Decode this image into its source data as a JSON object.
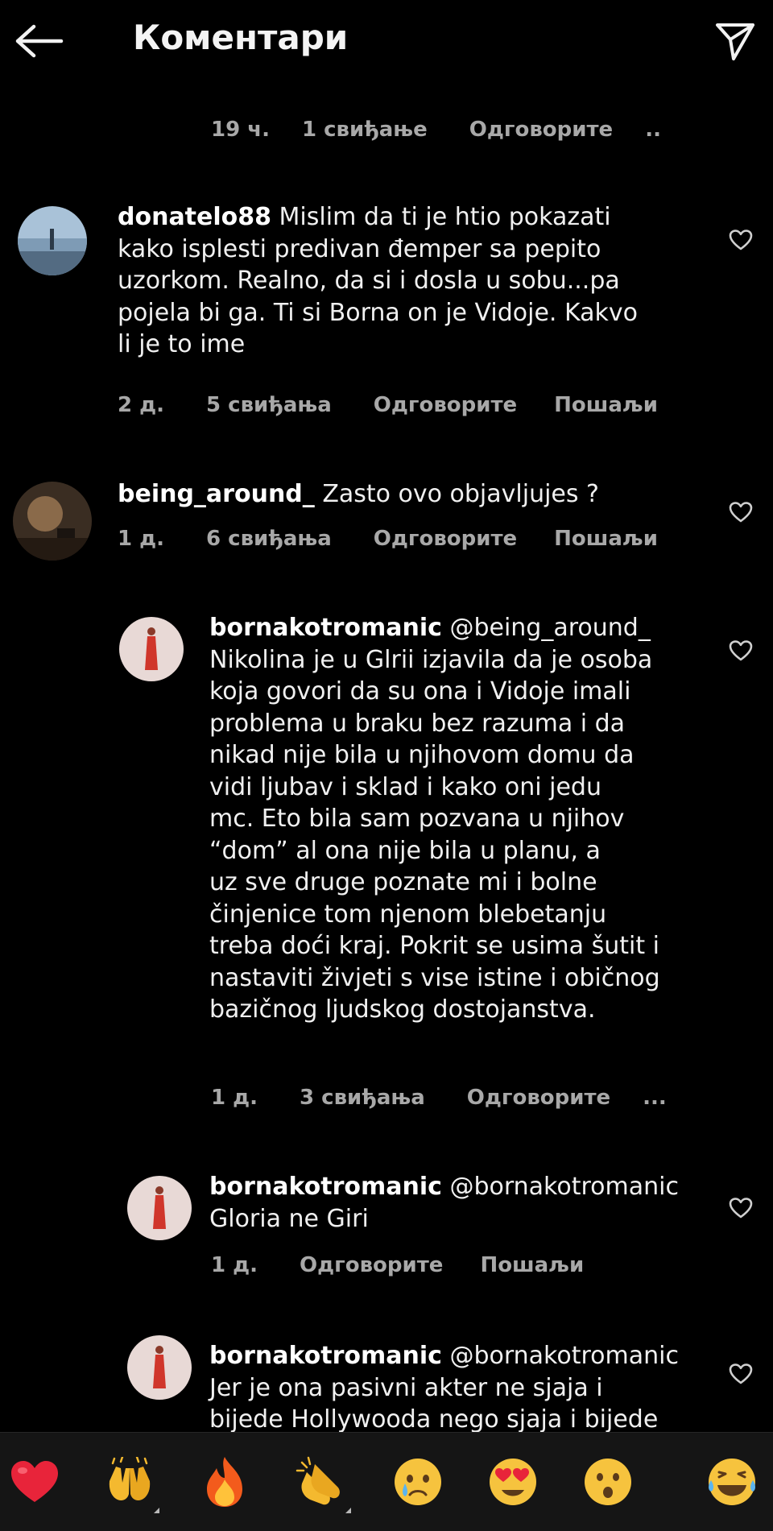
{
  "header": {
    "title": "Коментари",
    "back_icon": "arrow-left-icon",
    "share_icon": "send-icon"
  },
  "top_meta": {
    "time": "19 ч.",
    "likes": "1 свиђање",
    "reply": "Одговорите",
    "more": ".."
  },
  "comments": [
    {
      "username": "donatelo88",
      "text": " Mislim da ti je htio pokazati\nkako isplesti predivan đemper sa pepito\nuzorkom. Realno, da si i dosla u sobu...pa\npojela bi ga. Ti si Borna on je Vidoje. Kakvo\nli je to ime",
      "time": "2 д.",
      "likes": "5 свиђања",
      "reply": "Одговорите",
      "send": "Пошаљи"
    },
    {
      "username": "being_around_",
      "text": " Zasto ovo objavljujes ?",
      "time": "1 д.",
      "likes": "6 свиђања",
      "reply": "Одговорите",
      "send": "Пошаљи"
    },
    {
      "username": "bornakotromanic",
      "text": " @being_around_\nNikolina je u Glrii izjavila da je osoba\nkoja govori da su ona i Vidoje imali\nproblema u braku bez razuma i da\nnikad nije bila u njihovom domu da\nvidi ljubav i sklad i kako oni jedu\nmc. Eto bila sam pozvana u njihov\n“dom” al ona nije bila u planu, a\nuz sve druge poznate mi i bolne\nčinjenice tom njenom blebetanju\ntreba doći kraj. Pokrit se usima šutit i\nnastaviti živjeti s vise istine i običnog\nbazičnog ljudskog dostojanstva.",
      "time": "1 д.",
      "likes": "3 свиђања",
      "reply": "Одговорите",
      "more": "..."
    },
    {
      "username": "bornakotromanic",
      "text": " @bornakotromanic\nGloria ne Giri",
      "time": "1 д.",
      "reply": "Одговорите",
      "send": "Пошаљи"
    },
    {
      "username": "bornakotromanic",
      "text": " @bornakotromanic\nJer je ona pasivni akter ne sjaja i\nbijede Hollywooda nego sjaja i bijede"
    }
  ],
  "emoji_bar": [
    "❤️",
    "🙌",
    "🔥",
    "👏",
    "😢",
    "😍",
    "😮",
    "😂"
  ],
  "emoji_names": [
    "red-heart-emoji-icon",
    "raised-hands-emoji-icon",
    "fire-emoji-icon",
    "clapping-hands-emoji-icon",
    "crying-face-emoji-icon",
    "heart-eyes-emoji-icon",
    "surprised-face-emoji-icon",
    "laughing-tears-emoji-icon"
  ],
  "colors": {
    "background": "#000000",
    "text": "#f0f0f0",
    "meta": "#a8a8a8",
    "emoji_bar": "#151515"
  }
}
